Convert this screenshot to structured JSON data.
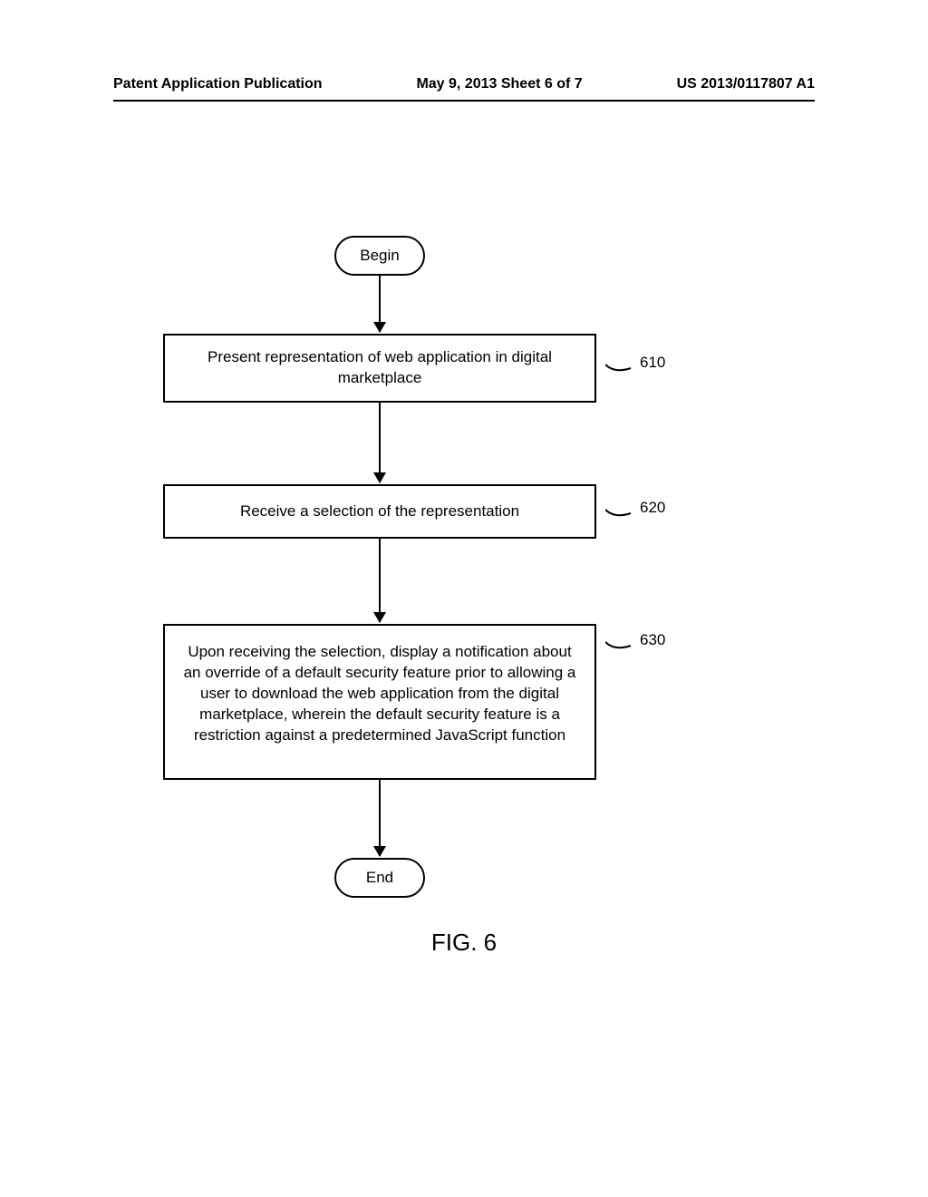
{
  "header": {
    "left": "Patent Application Publication",
    "center": "May 9, 2013  Sheet 6 of 7",
    "right": "US 2013/0117807 A1"
  },
  "flow": {
    "begin": "Begin",
    "step1": "Present representation of web application in digital marketplace",
    "step2": "Receive a selection of the representation",
    "step3": "Upon receiving the selection, display a notification about an override of a default security feature prior to allowing a user to download the web application from the digital marketplace, wherein the default security feature is a restriction against a predetermined JavaScript function",
    "end": "End"
  },
  "refs": {
    "r1": "610",
    "r2": "620",
    "r3": "630"
  },
  "caption": "FIG. 6"
}
